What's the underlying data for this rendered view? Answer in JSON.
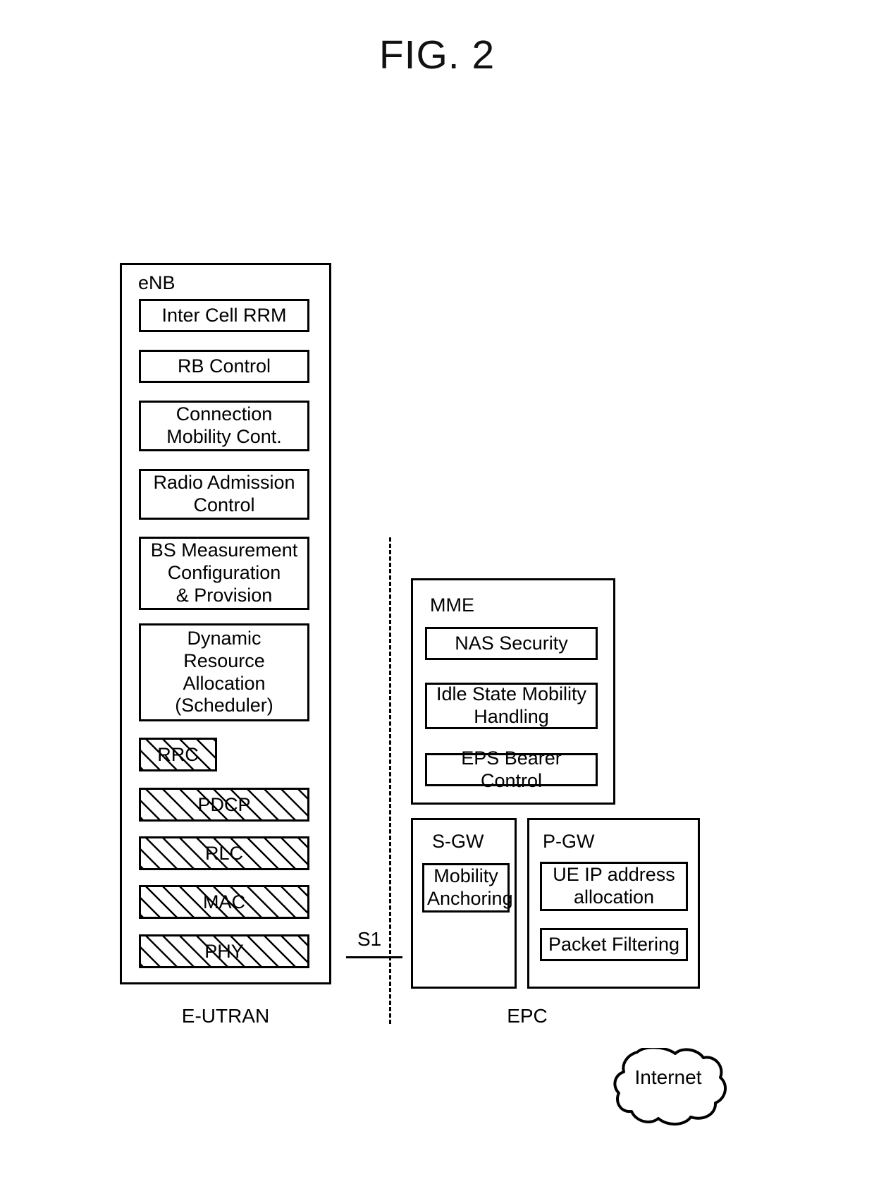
{
  "figure": {
    "title": "FIG. 2"
  },
  "enb": {
    "title": "eNB",
    "functions": [
      {
        "label": "Inter Cell RRM"
      },
      {
        "label": "RB Control"
      },
      {
        "label": "Connection\nMobility Cont."
      },
      {
        "label": "Radio Admission\nControl"
      },
      {
        "label": "BS Measurement\nConfiguration\n& Provision"
      },
      {
        "label": "Dynamic Resource\nAllocation\n(Scheduler)"
      }
    ],
    "protocol_layers": [
      {
        "label": "RRC"
      },
      {
        "label": "PDCP"
      },
      {
        "label": "RLC"
      },
      {
        "label": "MAC"
      },
      {
        "label": "PHY"
      }
    ]
  },
  "mme": {
    "title": "MME",
    "functions": [
      {
        "label": "NAS Security"
      },
      {
        "label": "Idle State Mobility\nHandling"
      },
      {
        "label": "EPS Bearer Control"
      }
    ]
  },
  "sgw": {
    "title": "S-GW",
    "functions": [
      {
        "label": "Mobility\nAnchoring"
      }
    ]
  },
  "pgw": {
    "title": "P-GW",
    "functions": [
      {
        "label": "UE IP address\nallocation"
      },
      {
        "label": "Packet Filtering"
      }
    ]
  },
  "interface": {
    "s1_label": "S1"
  },
  "captions": {
    "left": "E-UTRAN",
    "right": "EPC"
  },
  "internet": {
    "label": "Internet"
  },
  "colors": {
    "line": "#000000",
    "background": "#ffffff"
  }
}
